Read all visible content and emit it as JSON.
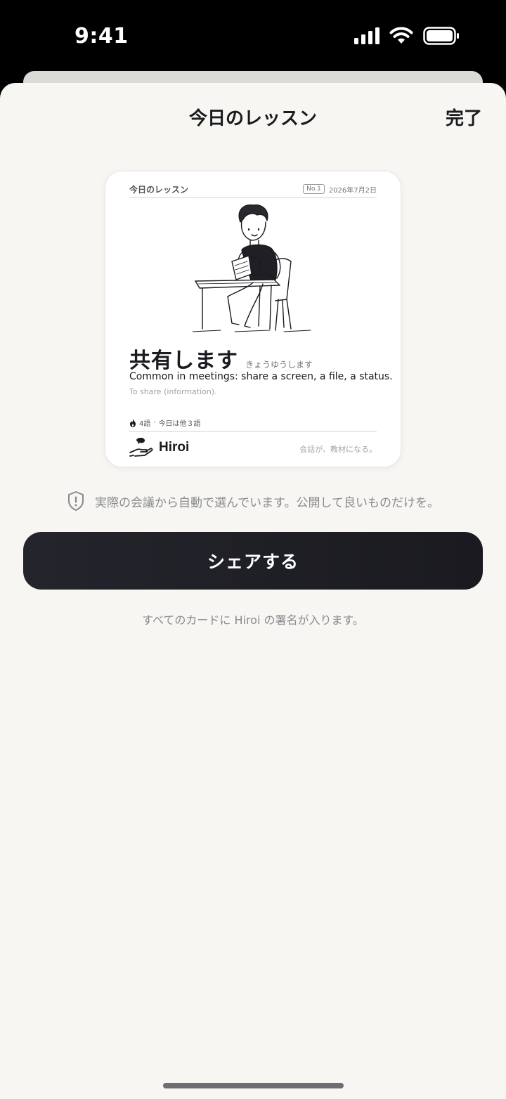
{
  "status_bar": {
    "time": "9:41"
  },
  "sheet": {
    "title": "今日のレッスン",
    "done_label": "完了"
  },
  "card": {
    "header_title": "今日のレッスン",
    "number": "No.1",
    "date": "2026年7月2日",
    "word": "共有します",
    "reading": "きょうゆうします",
    "usage": "Common in meetings: share a screen, a file, a status.",
    "meaning": "To share (information).",
    "stats": {
      "icon": "flame-icon",
      "word_count": "4語",
      "separator": "·",
      "others_today": "今日は他３語"
    },
    "brand_name": "Hiroi",
    "tagline": "会話が、教材になる。"
  },
  "notice": {
    "icon": "shield-icon",
    "text": "実際の会議から自動で選んでいます。公開して良いものだけを。"
  },
  "share_button_label": "シェアする",
  "footnote": "すべてのカードに Hiroi の署名が入ります。",
  "colors": {
    "sheet_background": "#f7f6f2",
    "button_background": "#1f1f26",
    "muted_text": "#8a8a8f"
  }
}
